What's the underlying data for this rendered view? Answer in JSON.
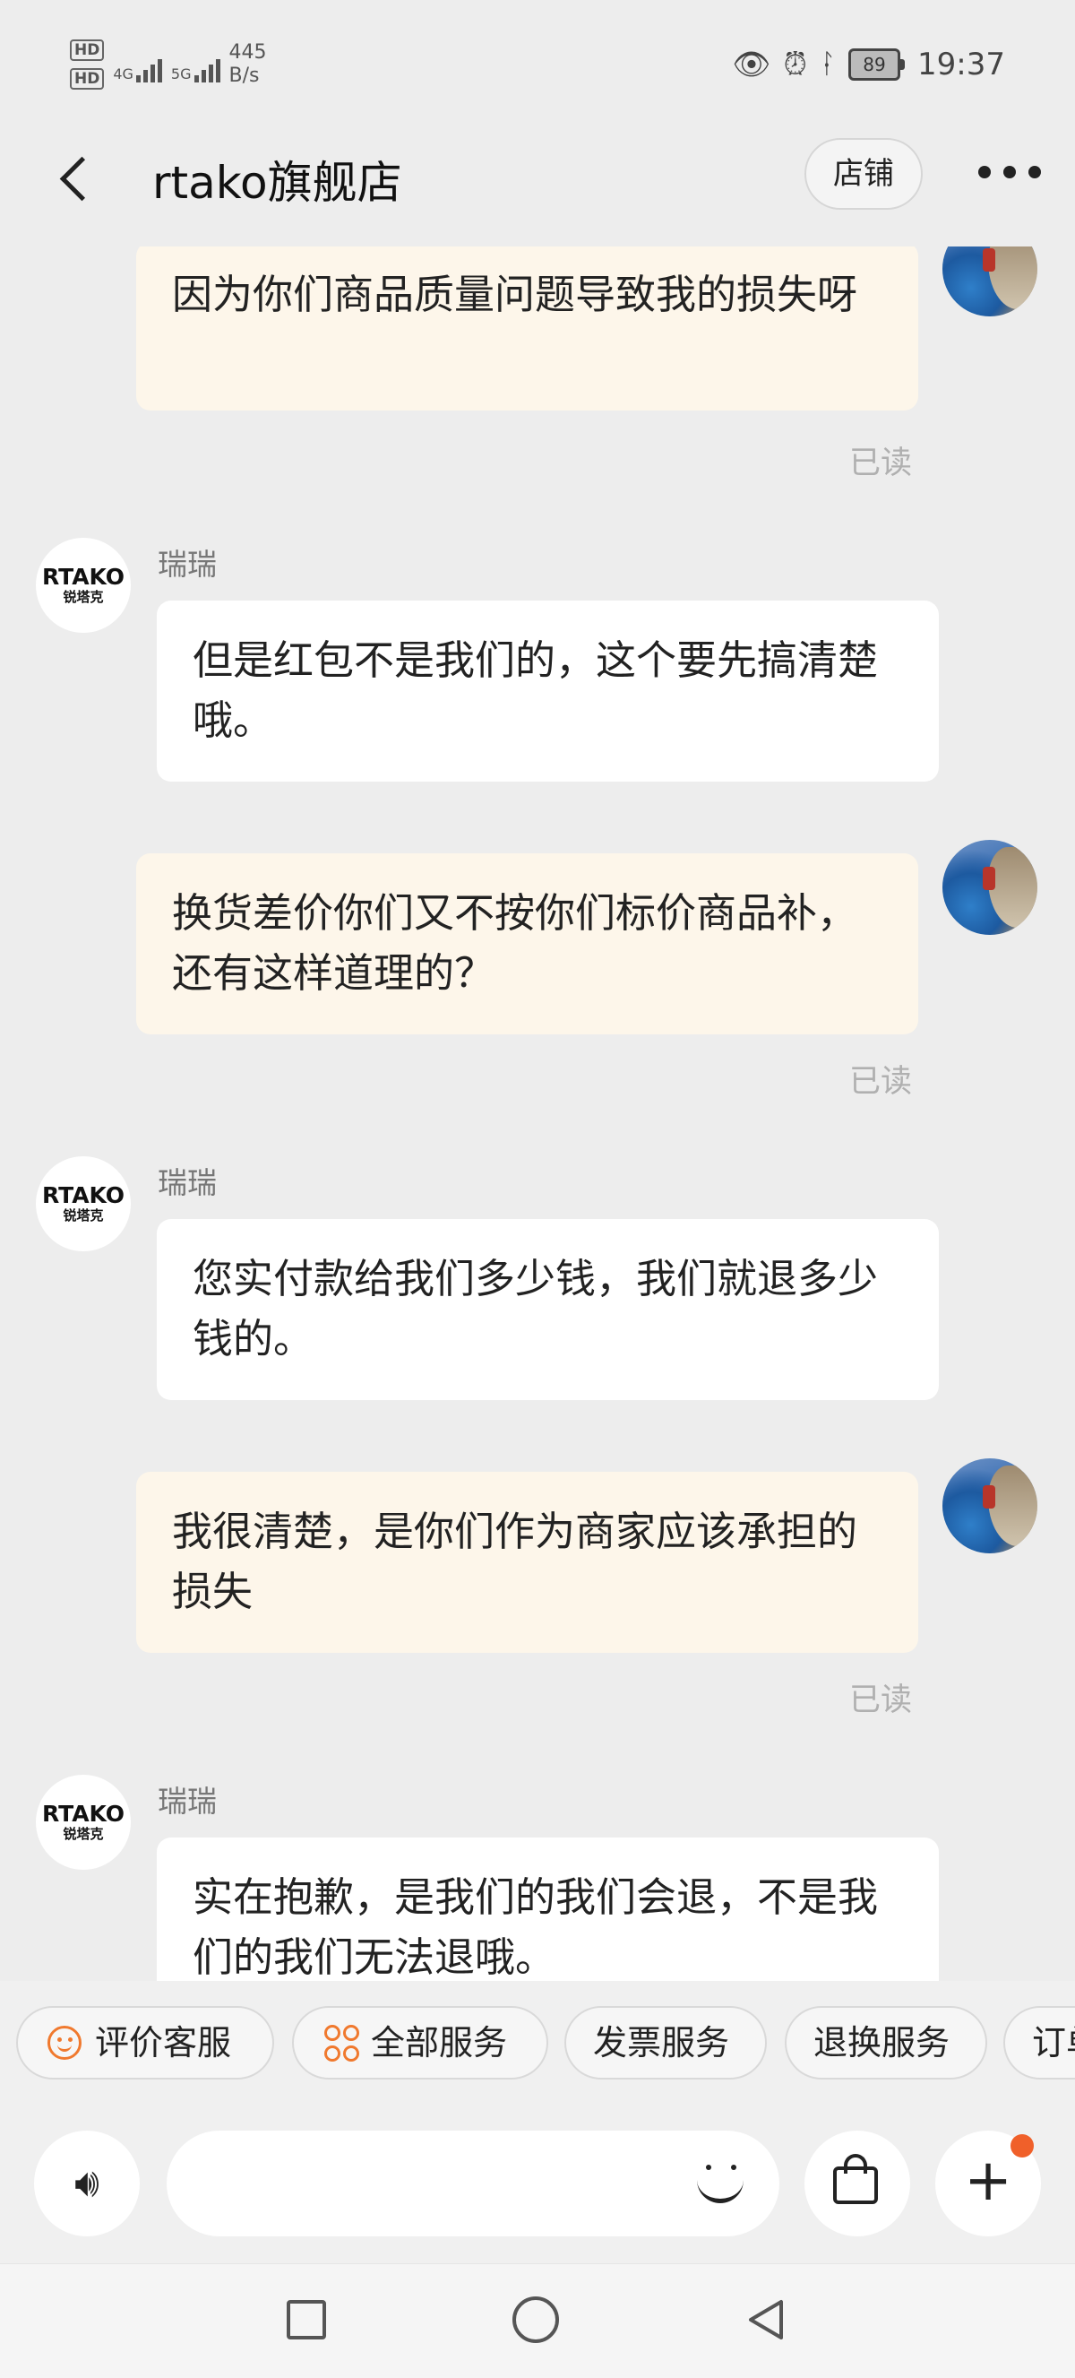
{
  "status_bar": {
    "hd1": "HD",
    "hd2": "HD",
    "net1": "4G",
    "net2": "5G",
    "speed_value": "445",
    "speed_unit": "B/s",
    "battery": "89",
    "time": "19:37"
  },
  "header": {
    "title": "rtako旗舰店",
    "store_button": "店铺"
  },
  "shop": {
    "avatar_brand": "RTAKO",
    "avatar_brand_cn": "锐塔克",
    "agent_name": "瑞瑞"
  },
  "messages": [
    {
      "from": "me",
      "text": "因为你们商品质量问题导致我的损失呀",
      "status": "已读"
    },
    {
      "from": "shop",
      "sender": "瑞瑞",
      "text": "但是红包不是我们的，这个要先搞清楚哦。"
    },
    {
      "from": "me",
      "text": "换货差价你们又不按你们标价商品补，还有这样道理的？",
      "status": "已读"
    },
    {
      "from": "shop",
      "sender": "瑞瑞",
      "text": "您实付款给我们多少钱，我们就退多少钱的。"
    },
    {
      "from": "me",
      "text": "我很清楚，是你们作为商家应该承担的损失",
      "status": "已读"
    },
    {
      "from": "shop",
      "sender": "瑞瑞",
      "text": "实在抱歉，是我们的我们会退，不是我们的我们无法退哦。"
    }
  ],
  "quick_services": [
    "评价客服",
    "全部服务",
    "发票服务",
    "退换服务",
    "订单"
  ],
  "input": {
    "placeholder": ""
  },
  "colors": {
    "accent": "#f0792e",
    "my_bubble": "#fdf6ea",
    "their_bubble": "#ffffff",
    "background": "#ededed",
    "badge": "#f0602a"
  }
}
